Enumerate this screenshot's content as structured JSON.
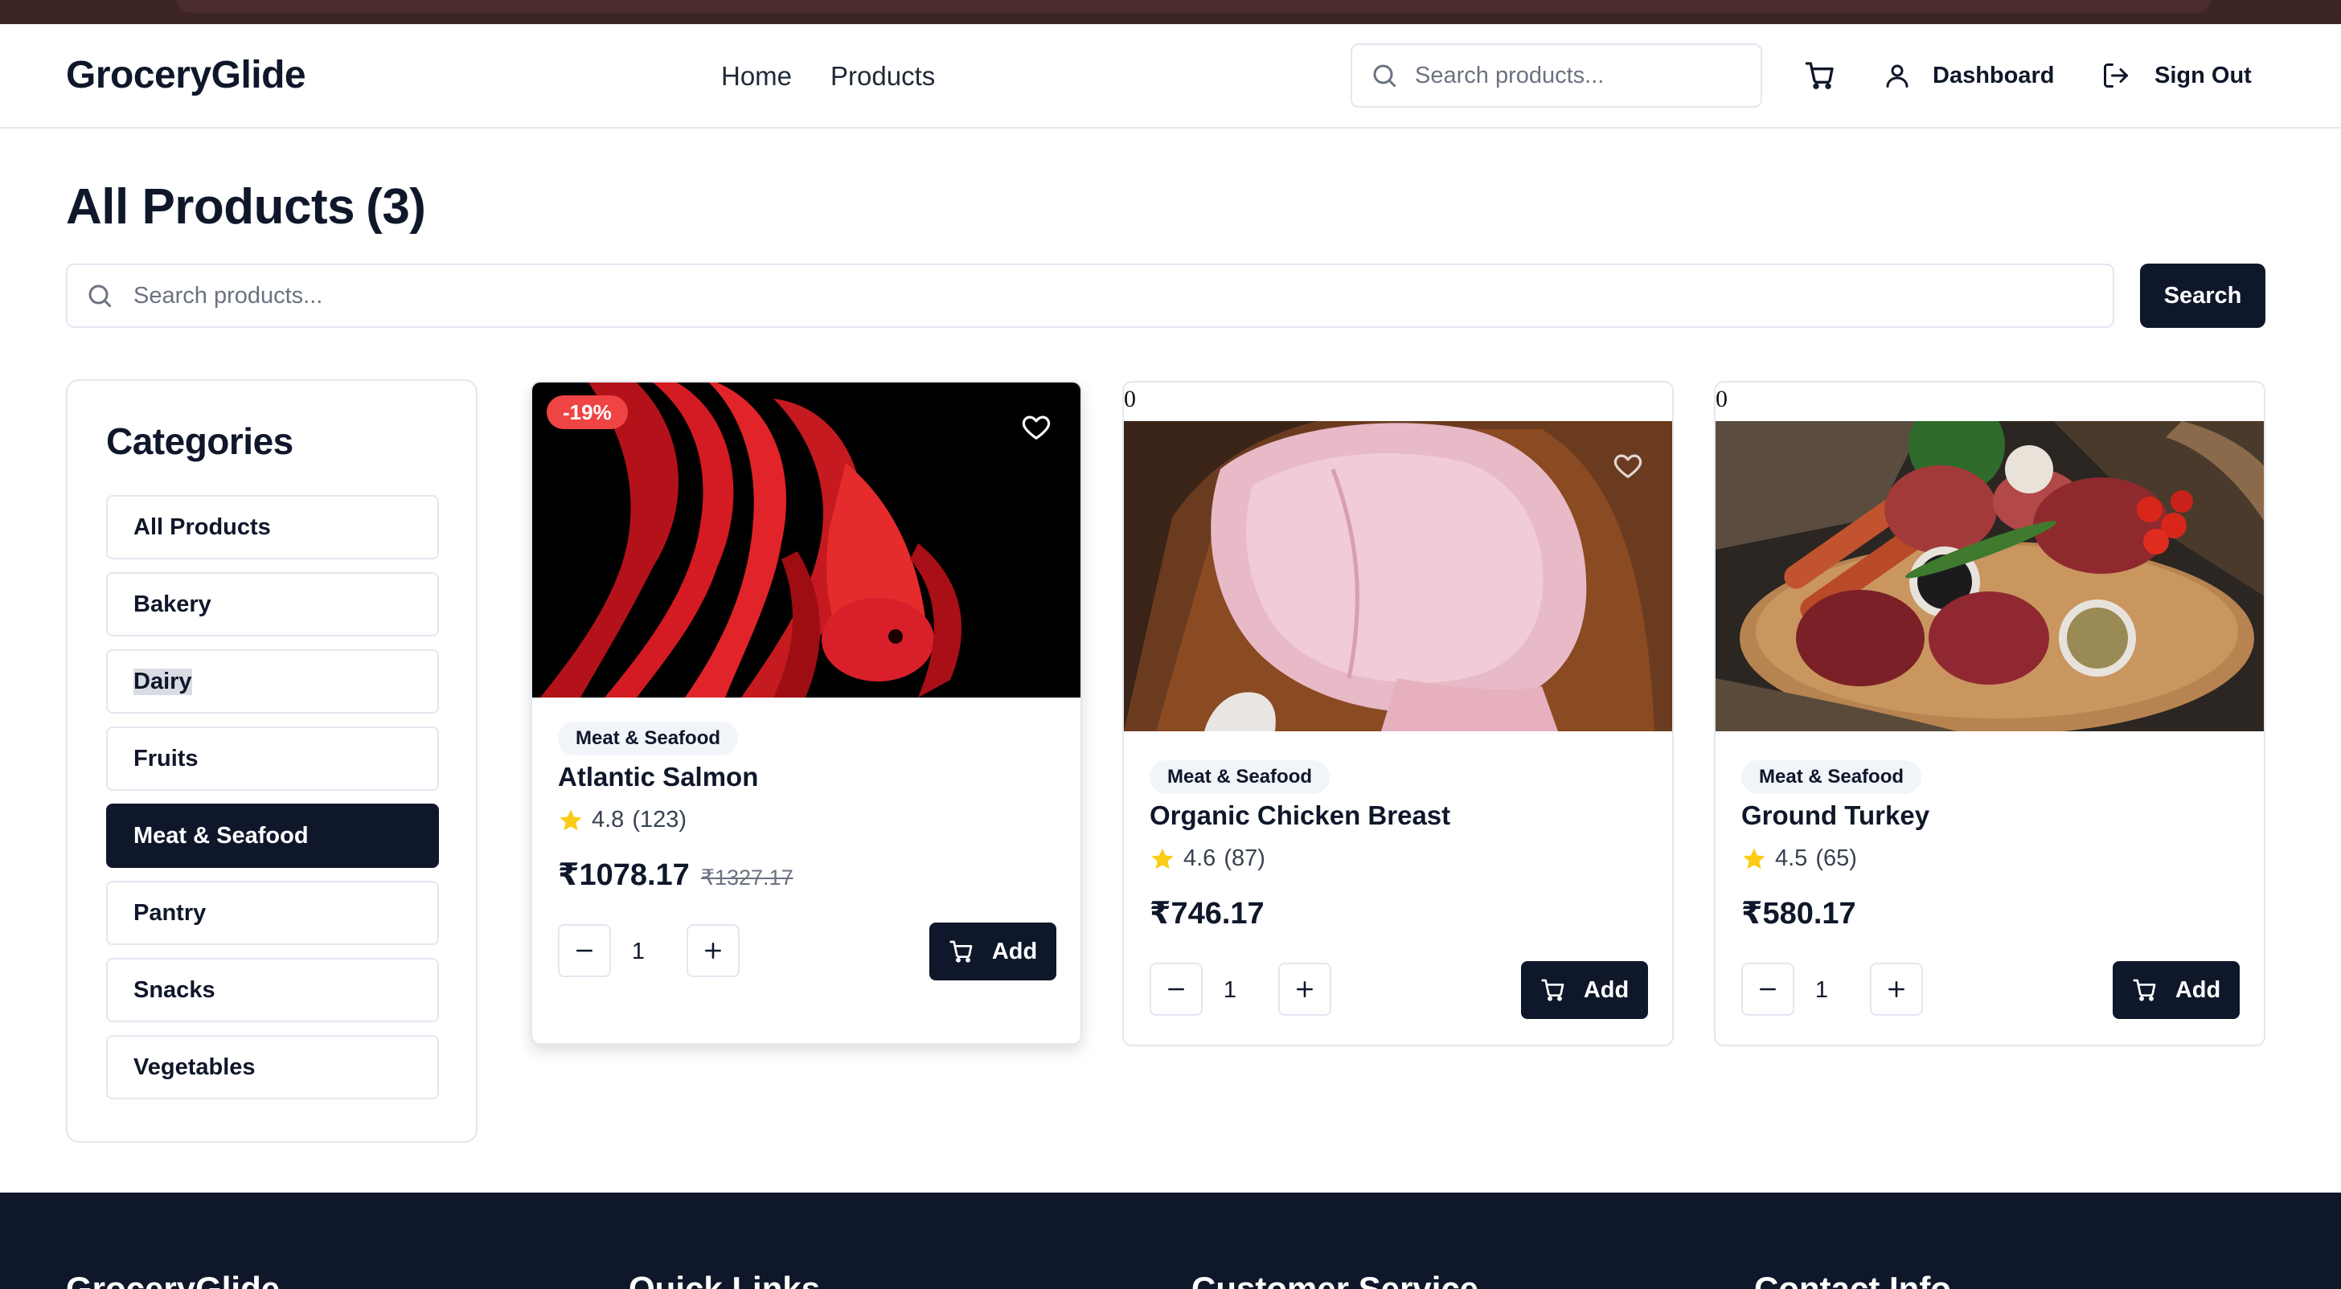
{
  "brand": {
    "name": "GroceryGlide"
  },
  "nav": {
    "home": "Home",
    "products": "Products"
  },
  "header": {
    "search_placeholder": "Search products...",
    "dashboard": "Dashboard",
    "sign_out": "Sign Out"
  },
  "page": {
    "title": "All Products",
    "count": "(3)",
    "search_placeholder": "Search products...",
    "search_button": "Search"
  },
  "categories": {
    "title": "Categories",
    "items": [
      {
        "label": "All Products"
      },
      {
        "label": "Bakery"
      },
      {
        "label": "Dairy"
      },
      {
        "label": "Fruits"
      },
      {
        "label": "Meat & Seafood",
        "active": true
      },
      {
        "label": "Pantry"
      },
      {
        "label": "Snacks"
      },
      {
        "label": "Vegetables"
      }
    ]
  },
  "products": [
    {
      "name": "Atlantic Salmon",
      "category": "Meat & Seafood",
      "rating": "4.8",
      "reviews": "(123)",
      "price": "₹1078.17",
      "old_price": "₹1327.17",
      "discount": "-19%",
      "qty": "1",
      "add": "Add"
    },
    {
      "name": "Organic Chicken Breast",
      "category": "Meat & Seafood",
      "rating": "4.6",
      "reviews": "(87)",
      "price": "₹746.17",
      "qty": "1",
      "add": "Add",
      "stray_text": "0"
    },
    {
      "name": "Ground Turkey",
      "category": "Meat & Seafood",
      "rating": "4.5",
      "reviews": "(65)",
      "price": "₹580.17",
      "qty": "1",
      "add": "Add",
      "stray_text": "0"
    }
  ],
  "footer": {
    "brand": "GroceryGlide",
    "quick_links": "Quick Links",
    "customer_service": "Customer Service",
    "contact_info": "Contact Info"
  },
  "colors": {
    "primary": "#0f172a",
    "discount": "#ef4444",
    "star": "#facc15",
    "border": "#e2e8f0"
  },
  "icons": [
    "search-icon",
    "cart-icon",
    "user-icon",
    "sign-out-icon",
    "heart-icon",
    "star-icon",
    "minus-icon",
    "plus-icon"
  ]
}
